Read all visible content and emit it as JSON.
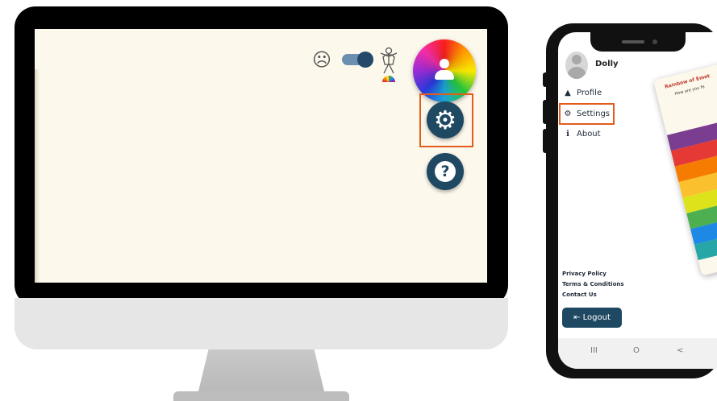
{
  "desktop": {
    "mood_icon": "sad-face-icon",
    "mood_glyph": "☹",
    "toggle_state": "on",
    "body_icon": "body-outline-icon",
    "profile_icon": "user-icon",
    "settings_icon": "gear-icon",
    "settings_glyph": "⚙",
    "help_icon": "question-icon",
    "help_glyph": "?"
  },
  "phone": {
    "user_name": "Dolly",
    "menu": [
      {
        "label": "Profile",
        "icon": "person-icon",
        "glyph": "👤"
      },
      {
        "label": "Settings",
        "icon": "gear-icon",
        "glyph": "⚙"
      },
      {
        "label": "About",
        "icon": "info-icon",
        "glyph": "ℹ"
      }
    ],
    "footer_links": [
      "Privacy Policy",
      "Terms & Conditions",
      "Contact Us"
    ],
    "logout_label": "Logout",
    "logout_glyph": "⇤",
    "nav_buttons": [
      "III",
      "O",
      "<"
    ],
    "card": {
      "title": "Rainbow of Emot",
      "subtitle": "How are you fe"
    }
  },
  "colors": {
    "accent": "#1f4863",
    "highlight": "#e25c1c",
    "screen_bg": "#fdf8ec",
    "rainbow": [
      "#7b3d8f",
      "#e53935",
      "#f57c00",
      "#fbc02d",
      "#dce31a",
      "#4caf50",
      "#1e88e5",
      "#26a6a6"
    ]
  }
}
